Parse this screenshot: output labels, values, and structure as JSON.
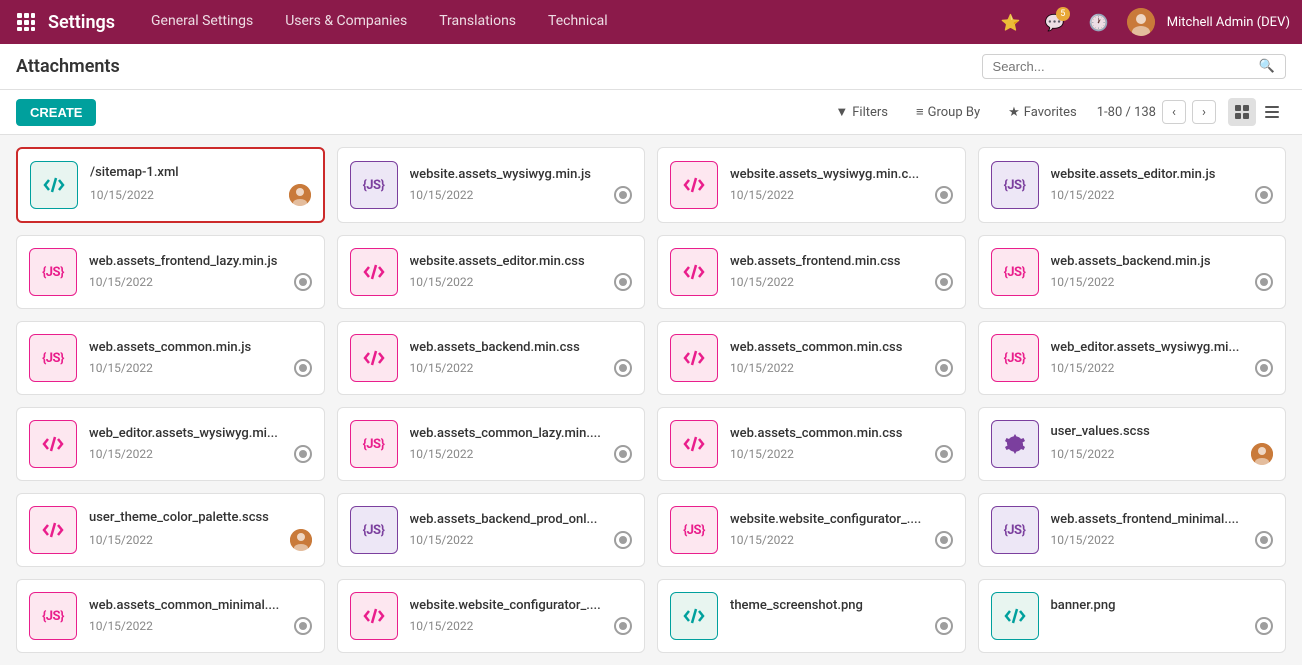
{
  "topbar": {
    "brand": "Settings",
    "nav_items": [
      {
        "label": "General Settings",
        "id": "general-settings"
      },
      {
        "label": "Users & Companies",
        "id": "users-companies"
      },
      {
        "label": "Translations",
        "id": "translations"
      },
      {
        "label": "Technical",
        "id": "technical"
      }
    ],
    "notifications_count": "5",
    "username": "Mitchell Admin (DEV)"
  },
  "page": {
    "title": "Attachments",
    "create_label": "CREATE"
  },
  "toolbar": {
    "search_placeholder": "Search...",
    "filters_label": "Filters",
    "groupby_label": "Group By",
    "favorites_label": "Favorites",
    "pagination": "1-80 / 138"
  },
  "cards": [
    {
      "id": 1,
      "name": "/sitemap-1.xml",
      "date": "10/15/2022",
      "icon_type": "xml",
      "icon_text": "</>",
      "has_avatar": true,
      "selected": true
    },
    {
      "id": 2,
      "name": "website.assets_wysiwyg.min.js",
      "date": "10/15/2022",
      "icon_type": "js-purple",
      "icon_text": "{JS}",
      "has_avatar": false
    },
    {
      "id": 3,
      "name": "website.assets_wysiwyg.min.c...",
      "date": "10/15/2022",
      "icon_type": "css-pink",
      "icon_text": "</>",
      "has_avatar": false
    },
    {
      "id": 4,
      "name": "website.assets_editor.min.js",
      "date": "10/15/2022",
      "icon_type": "js-purple",
      "icon_text": "{JS}",
      "has_avatar": false
    },
    {
      "id": 5,
      "name": "web.assets_frontend_lazy.min.js",
      "date": "10/15/2022",
      "icon_type": "js-pink",
      "icon_text": "{JS}",
      "has_avatar": false
    },
    {
      "id": 6,
      "name": "website.assets_editor.min.css",
      "date": "10/15/2022",
      "icon_type": "css-pink",
      "icon_text": "</>",
      "has_avatar": false
    },
    {
      "id": 7,
      "name": "web.assets_frontend.min.css",
      "date": "10/15/2022",
      "icon_type": "css-pink",
      "icon_text": "</>",
      "has_avatar": false
    },
    {
      "id": 8,
      "name": "web.assets_backend.min.js",
      "date": "10/15/2022",
      "icon_type": "js-pink",
      "icon_text": "{JS}",
      "has_avatar": false
    },
    {
      "id": 9,
      "name": "web.assets_common.min.js",
      "date": "10/15/2022",
      "icon_type": "js-pink",
      "icon_text": "{JS}",
      "has_avatar": false
    },
    {
      "id": 10,
      "name": "web.assets_backend.min.css",
      "date": "10/15/2022",
      "icon_type": "css-pink",
      "icon_text": "</>",
      "has_avatar": false
    },
    {
      "id": 11,
      "name": "web.assets_common.min.css",
      "date": "10/15/2022",
      "icon_type": "css-pink",
      "icon_text": "</>",
      "has_avatar": false
    },
    {
      "id": 12,
      "name": "web_editor.assets_wysiwyg.mi...",
      "date": "10/15/2022",
      "icon_type": "js-pink",
      "icon_text": "{JS}",
      "has_avatar": false
    },
    {
      "id": 13,
      "name": "web_editor.assets_wysiwyg.mi...",
      "date": "10/15/2022",
      "icon_type": "css-pink",
      "icon_text": "</>",
      "has_avatar": false
    },
    {
      "id": 14,
      "name": "web.assets_common_lazy.min....",
      "date": "10/15/2022",
      "icon_type": "js-pink",
      "icon_text": "{JS}",
      "has_avatar": false
    },
    {
      "id": 15,
      "name": "web.assets_common.min.css",
      "date": "10/15/2022",
      "icon_type": "css-pink",
      "icon_text": "</>",
      "has_avatar": false
    },
    {
      "id": 16,
      "name": "user_values.scss",
      "date": "10/15/2022",
      "icon_type": "gear",
      "icon_text": "⚙",
      "has_avatar": true
    },
    {
      "id": 17,
      "name": "user_theme_color_palette.scss",
      "date": "10/15/2022",
      "icon_type": "css-pink",
      "icon_text": "</>",
      "has_avatar": true
    },
    {
      "id": 18,
      "name": "web.assets_backend_prod_onl...",
      "date": "10/15/2022",
      "icon_type": "js-purple",
      "icon_text": "{JS}",
      "has_avatar": false
    },
    {
      "id": 19,
      "name": "website.website_configurator_....",
      "date": "10/15/2022",
      "icon_type": "js-pink",
      "icon_text": "{JS}",
      "has_avatar": false
    },
    {
      "id": 20,
      "name": "web.assets_frontend_minimal....",
      "date": "10/15/2022",
      "icon_type": "js-purple",
      "icon_text": "{JS}",
      "has_avatar": false
    },
    {
      "id": 21,
      "name": "web.assets_common_minimal....",
      "date": "10/15/2022",
      "icon_type": "js-pink",
      "icon_text": "{JS}",
      "has_avatar": false
    },
    {
      "id": 22,
      "name": "website.website_configurator_....",
      "date": "10/15/2022",
      "icon_type": "css-pink",
      "icon_text": "</>",
      "has_avatar": false
    },
    {
      "id": 23,
      "name": "theme_screenshot.png",
      "date": "",
      "icon_type": "css-teal",
      "icon_text": "</>",
      "has_avatar": false
    },
    {
      "id": 24,
      "name": "banner.png",
      "date": "",
      "icon_type": "css-teal",
      "icon_text": "</>",
      "has_avatar": false
    }
  ]
}
